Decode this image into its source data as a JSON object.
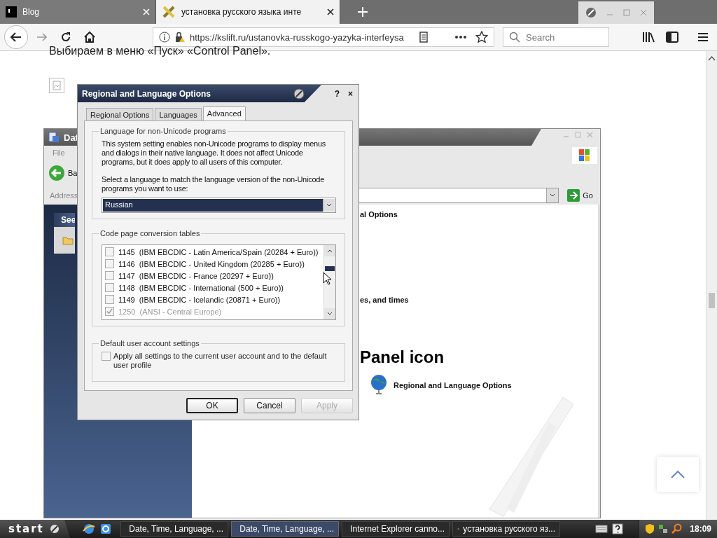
{
  "browser": {
    "tabs": [
      {
        "title": "Blog",
        "selected": false
      },
      {
        "title": "установка русского языка инте",
        "selected": true
      }
    ],
    "url": "https://kslift.ru/ustanovka-russkogo-yazyka-interfeysa",
    "search": {
      "placeholder": "Search"
    }
  },
  "page": {
    "text": "Выбираем в меню «Пуск» «Control Panel»."
  },
  "background_window": {
    "title": "Dat",
    "menu": [
      "File"
    ],
    "back_label": "Ba",
    "address_label": "Address",
    "go_label": "Go",
    "see_also": "See",
    "content": [
      {
        "kind": "heading",
        "text": "al Options"
      },
      {
        "kind": "heading",
        "text": "es, and times"
      },
      {
        "kind": "title",
        "text": "Panel icon"
      },
      {
        "kind": "link",
        "text": "Regional and Language Options"
      }
    ]
  },
  "dialog": {
    "title": "Regional and Language Options",
    "help": "?",
    "close": "×",
    "tabs": [
      {
        "label": "Regional Options",
        "selected": false
      },
      {
        "label": "Languages",
        "selected": false
      },
      {
        "label": "Advanced",
        "selected": true
      }
    ],
    "language_group": {
      "label": "Language for non-Unicode programs",
      "description": "This system setting enables non-Unicode programs to display menus and dialogs in their native language. It does not affect Unicode programs, but it does apply to all users of this computer.",
      "prompt": "Select a language to match the language version of the non-Unicode programs you want to use:",
      "value": "Russian"
    },
    "code_pages": {
      "label": "Code page conversion tables",
      "rows": [
        {
          "code": "1145",
          "name": "(IBM EBCDIC - Latin America/Spain (20284 + Euro))",
          "checked": false,
          "disabled": false
        },
        {
          "code": "1146",
          "name": "(IBM EBCDIC - United Kingdom (20285 + Euro))",
          "checked": false,
          "disabled": false
        },
        {
          "code": "1147",
          "name": "(IBM EBCDIC - France (20297 + Euro))",
          "checked": false,
          "disabled": false
        },
        {
          "code": "1148",
          "name": "(IBM EBCDIC - International (500 + Euro))",
          "checked": false,
          "disabled": false
        },
        {
          "code": "1149",
          "name": "(IBM EBCDIC - Icelandic (20871 + Euro))",
          "checked": false,
          "disabled": false
        },
        {
          "code": "1250",
          "name": "(ANSI - Central Europe)",
          "checked": true,
          "disabled": true
        }
      ]
    },
    "defaults": {
      "label": "Default user account settings",
      "option": "Apply all settings to the current user account and to the default user profile",
      "checked": false
    },
    "buttons": [
      {
        "label": "OK",
        "default": true,
        "disabled": false
      },
      {
        "label": "Cancel",
        "default": false,
        "disabled": false
      },
      {
        "label": "Apply",
        "default": false,
        "disabled": true
      }
    ]
  },
  "taskbar": {
    "start": "start",
    "tasks": [
      {
        "label": "Date, Time, Language, ...",
        "selected": false
      },
      {
        "label": "Date, Time, Language, ...",
        "selected": true
      },
      {
        "label": "Internet Explorer canno...",
        "selected": false
      },
      {
        "label": "установка русского яз...",
        "selected": false
      }
    ],
    "clock": "18:09"
  }
}
